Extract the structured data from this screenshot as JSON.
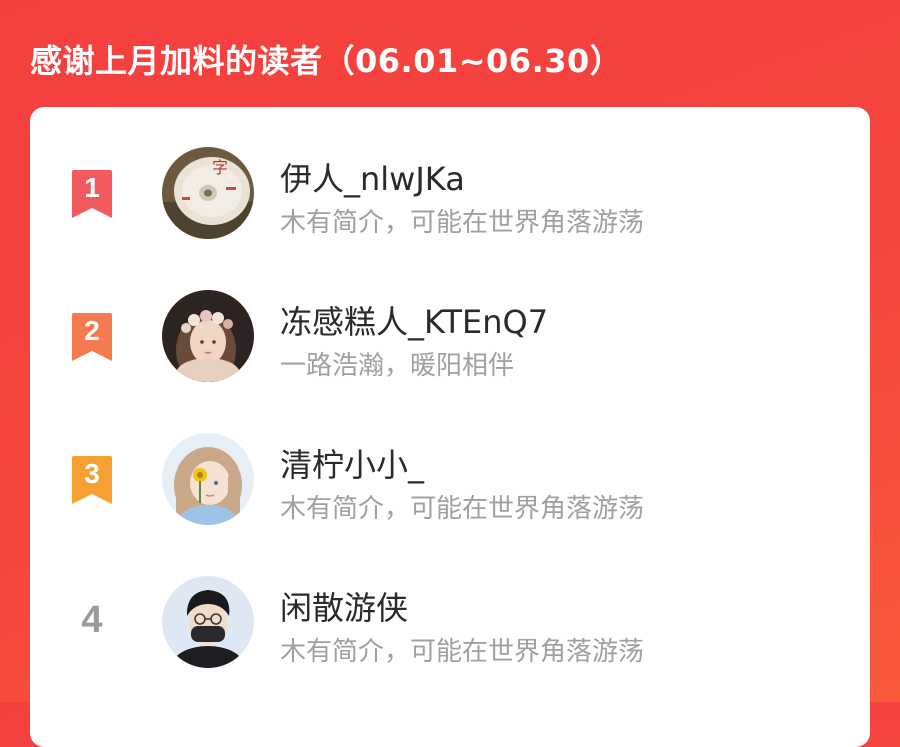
{
  "header": {
    "title": "感谢上月加料的读者（06.01~06.30）"
  },
  "colors": {
    "background": "#f4433e",
    "rank_1": "#f25a5e",
    "rank_2": "#f47a50",
    "rank_3": "#f5a030",
    "rank_other": "#9a9a9a"
  },
  "readers": [
    {
      "rank": "1",
      "name": "伊人_nlwJKa",
      "bio": "木有简介，可能在世界角落游荡",
      "avatar": "cd-disc-avatar"
    },
    {
      "rank": "2",
      "name": "冻感糕人_KTEnQ7",
      "bio": "一路浩瀚，暖阳相伴",
      "avatar": "flower-crown-girl-avatar"
    },
    {
      "rank": "3",
      "name": "清柠小小_",
      "bio": "木有简介，可能在世界角落游荡",
      "avatar": "anime-girl-avatar"
    },
    {
      "rank": "4",
      "name": "闲散游侠",
      "bio": "木有简介，可能在世界角落游荡",
      "avatar": "masked-boy-avatar"
    }
  ]
}
